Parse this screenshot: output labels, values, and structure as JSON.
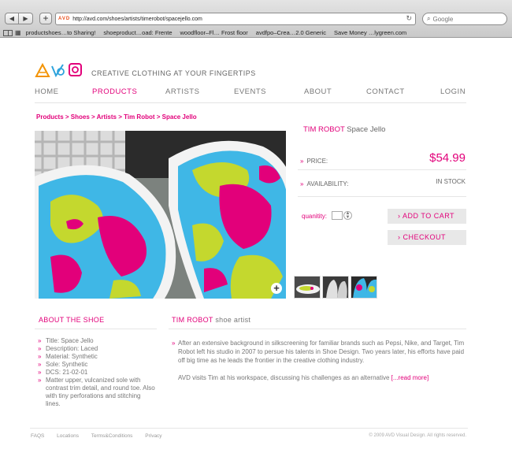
{
  "browser": {
    "url": "http://avd.com/shoes/artists/timerobot/spacejello.com",
    "search_placeholder": "Google",
    "favicon_text": "AVD",
    "bookmarks": [
      "productshoes…to Sharing!",
      "shoeproduct…oad: Frente",
      "woodfloor–Fl… Frost floor",
      "avdfpo–Crea…2.0 Generic",
      "Save Money …lygreen.com"
    ]
  },
  "header": {
    "tagline": "CREATIVE CLOTHING AT YOUR FINGERTIPS",
    "nav": [
      "HOME",
      "PRODUCTS",
      "ARTISTS",
      "EVENTS",
      "ABOUT",
      "CONTACT",
      "LOGIN"
    ],
    "active_nav": "PRODUCTS"
  },
  "breadcrumb": [
    "Products",
    "Shoes",
    "Artists",
    "Tim Robot",
    "Space Jello"
  ],
  "breadcrumb_sep": " > ",
  "product": {
    "artist": "TIM ROBOT",
    "name": "Space Jello",
    "price_label": "PRICE:",
    "price": "$54.99",
    "availability_label": "AVAILABILITY:",
    "availability": "IN STOCK",
    "quantity_label": "quanitity:",
    "add_to_cart": "ADD TO CART",
    "checkout": "CHECKOUT",
    "arrow": "»",
    "btn_arrow": "›"
  },
  "about": {
    "title": "ABOUT THE SHOE",
    "specs": [
      "Title: Space Jello",
      "Description: Laced",
      "Material: Synthetic",
      "Sole: Synthetic",
      "DCS: 21-02-01",
      "Matter upper, vulcanized sole with contrast trim detail, and round toe. Also with tiny perforations and stitching lines."
    ]
  },
  "artist_section": {
    "name": "TIM ROBOT",
    "role": "shoe artist",
    "bio_1": "After an extensive background in silkscreening for familiar brands such as Pepsi, Nike, and Target, Tim Robot left his studio in 2007 to persue his talents in Shoe Design. Two years later, his efforts have paid off big time as he leads the frontier in the creative clothing industry.",
    "bio_2": "AVD visits Tim at his workspace, discussing his challenges as an alternative ",
    "read_more": "[...read more]"
  },
  "footer": {
    "links": [
      "FAQS",
      "Locations",
      "Terms&Conditions",
      "Privacy"
    ],
    "copyright": "© 2009 AVD Visual Design. All rights reserved."
  },
  "colors": {
    "accent": "#e2007a",
    "logo_orange": "#f39200",
    "logo_blue": "#2ea3dc"
  },
  "icons": [
    "back-arrow-icon",
    "forward-arrow-icon",
    "reload-icon",
    "search-icon",
    "zoom-plus-icon",
    "bookmarks-book-icon",
    "bookmarks-grid-icon"
  ]
}
